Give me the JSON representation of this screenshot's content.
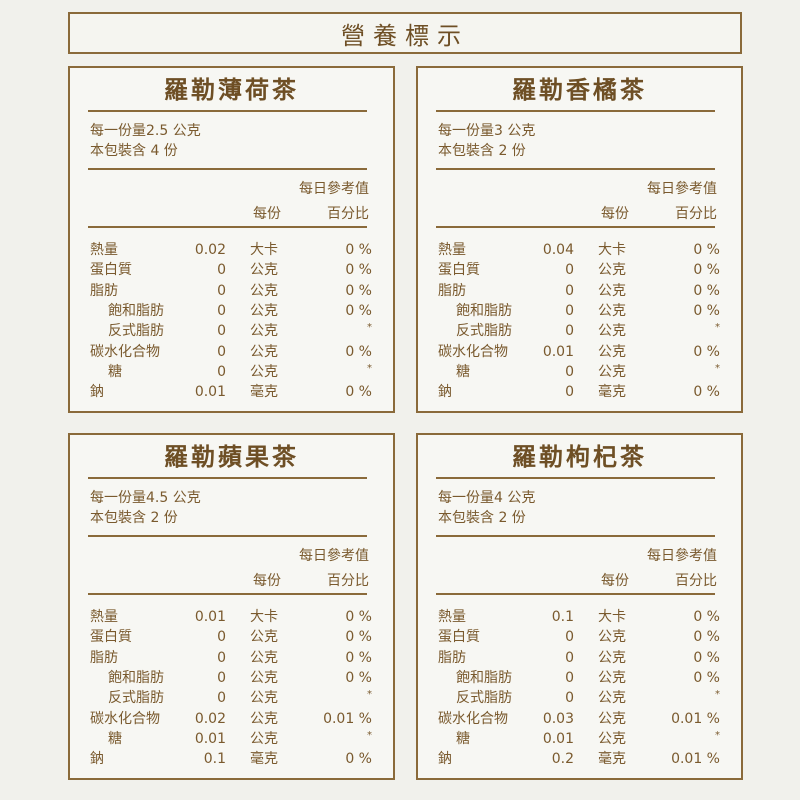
{
  "header": {
    "title": "營養標示"
  },
  "labels": {
    "daily": "每日參考值",
    "per_serving": "每份",
    "percent": "百分比"
  },
  "products": [
    {
      "name": "羅勒薄荷茶",
      "serving": "每一份量2.5 公克",
      "servings": "本包裝含 4 份",
      "rows": [
        {
          "name": "熱量",
          "amount": "0.02",
          "unit": "大卡",
          "pct": "0 %"
        },
        {
          "name": "蛋白質",
          "amount": "0",
          "unit": "公克",
          "pct": "0 %"
        },
        {
          "name": "脂肪",
          "amount": "0",
          "unit": "公克",
          "pct": "0 %"
        },
        {
          "name": "飽和脂肪",
          "amount": "0",
          "unit": "公克",
          "pct": "0 %"
        },
        {
          "name": "反式脂肪",
          "amount": "0",
          "unit": "公克",
          "pct": "*"
        },
        {
          "name": "碳水化合物",
          "amount": "0",
          "unit": "公克",
          "pct": "0 %"
        },
        {
          "name": "糖",
          "amount": "0",
          "unit": "公克",
          "pct": "*"
        },
        {
          "name": "鈉",
          "amount": "0.01",
          "unit": "毫克",
          "pct": "0 %"
        }
      ]
    },
    {
      "name": "羅勒香橘茶",
      "serving": "每一份量3 公克",
      "servings": "本包裝含 2 份",
      "rows": [
        {
          "name": "熱量",
          "amount": "0.04",
          "unit": "大卡",
          "pct": "0 %"
        },
        {
          "name": "蛋白質",
          "amount": "0",
          "unit": "公克",
          "pct": "0 %"
        },
        {
          "name": "脂肪",
          "amount": "0",
          "unit": "公克",
          "pct": "0 %"
        },
        {
          "name": "飽和脂肪",
          "amount": "0",
          "unit": "公克",
          "pct": "0 %"
        },
        {
          "name": "反式脂肪",
          "amount": "0",
          "unit": "公克",
          "pct": "*"
        },
        {
          "name": "碳水化合物",
          "amount": "0.01",
          "unit": "公克",
          "pct": "0 %"
        },
        {
          "name": "糖",
          "amount": "0",
          "unit": "公克",
          "pct": "*"
        },
        {
          "name": "鈉",
          "amount": "0",
          "unit": "毫克",
          "pct": "0 %"
        }
      ]
    },
    {
      "name": "羅勒蘋果茶",
      "serving": "每一份量4.5 公克",
      "servings": "本包裝含 2 份",
      "rows": [
        {
          "name": "熱量",
          "amount": "0.01",
          "unit": "大卡",
          "pct": "0 %"
        },
        {
          "name": "蛋白質",
          "amount": "0",
          "unit": "公克",
          "pct": "0 %"
        },
        {
          "name": "脂肪",
          "amount": "0",
          "unit": "公克",
          "pct": "0 %"
        },
        {
          "name": "飽和脂肪",
          "amount": "0",
          "unit": "公克",
          "pct": "0 %"
        },
        {
          "name": "反式脂肪",
          "amount": "0",
          "unit": "公克",
          "pct": "*"
        },
        {
          "name": "碳水化合物",
          "amount": "0.02",
          "unit": "公克",
          "pct": "0.01 %"
        },
        {
          "name": "糖",
          "amount": "0.01",
          "unit": "公克",
          "pct": "*"
        },
        {
          "name": "鈉",
          "amount": "0.1",
          "unit": "毫克",
          "pct": "0 %"
        }
      ]
    },
    {
      "name": "羅勒枸杞茶",
      "serving": "每一份量4 公克",
      "servings": "本包裝含 2 份",
      "rows": [
        {
          "name": "熱量",
          "amount": "0.1",
          "unit": "大卡",
          "pct": "0 %"
        },
        {
          "name": "蛋白質",
          "amount": "0",
          "unit": "公克",
          "pct": "0 %"
        },
        {
          "name": "脂肪",
          "amount": "0",
          "unit": "公克",
          "pct": "0 %"
        },
        {
          "name": "飽和脂肪",
          "amount": "0",
          "unit": "公克",
          "pct": "0 %"
        },
        {
          "name": "反式脂肪",
          "amount": "0",
          "unit": "公克",
          "pct": "*"
        },
        {
          "name": "碳水化合物",
          "amount": "0.03",
          "unit": "公克",
          "pct": "0.01 %"
        },
        {
          "name": "糖",
          "amount": "0.01",
          "unit": "公克",
          "pct": "*"
        },
        {
          "name": "鈉",
          "amount": "0.2",
          "unit": "毫克",
          "pct": "0.01 %"
        }
      ]
    }
  ]
}
